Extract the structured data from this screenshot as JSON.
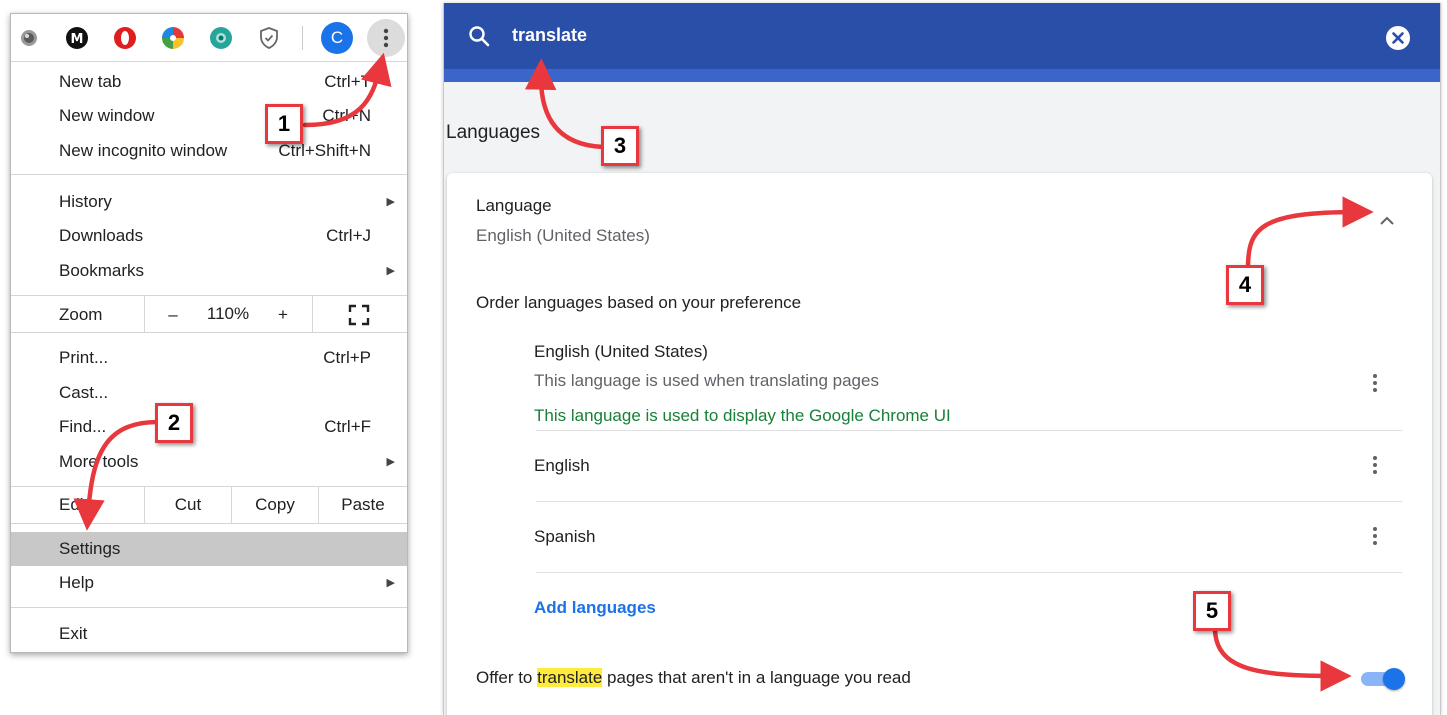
{
  "toolbar": {
    "profile_initial": "C",
    "extensions": [
      "circle-extension-icon",
      "dark-m-extension-icon",
      "opera-extension-icon",
      "colorwheel-extension-icon",
      "teal-extension-icon",
      "shield-extension-icon"
    ]
  },
  "menu": {
    "new_tab": {
      "label": "New tab",
      "shortcut": "Ctrl+T"
    },
    "new_window": {
      "label": "New window",
      "shortcut": "Ctrl+N"
    },
    "incognito": {
      "label": "New incognito window",
      "shortcut": "Ctrl+Shift+N"
    },
    "history": {
      "label": "History"
    },
    "downloads": {
      "label": "Downloads",
      "shortcut": "Ctrl+J"
    },
    "bookmarks": {
      "label": "Bookmarks"
    },
    "zoom": {
      "label": "Zoom",
      "minus": "–",
      "level": "110%",
      "plus": "+"
    },
    "print": {
      "label": "Print...",
      "shortcut": "Ctrl+P"
    },
    "cast": {
      "label": "Cast..."
    },
    "find": {
      "label": "Find...",
      "shortcut": "Ctrl+F"
    },
    "more_tools": {
      "label": "More tools"
    },
    "edit": {
      "label": "Edit",
      "cut": "Cut",
      "copy": "Copy",
      "paste": "Paste"
    },
    "settings": {
      "label": "Settings"
    },
    "help": {
      "label": "Help"
    },
    "exit": {
      "label": "Exit"
    }
  },
  "search": {
    "query": "translate"
  },
  "settings": {
    "section_title": "Languages",
    "language_label": "Language",
    "language_value": "English (United States)",
    "order_text": "Order languages based on your preference",
    "languages": [
      {
        "name": "English (United States)",
        "note": "This language is used when translating pages",
        "ui_note": "This language is used to display the Google Chrome UI"
      },
      {
        "name": "English"
      },
      {
        "name": "Spanish"
      }
    ],
    "add_languages": "Add languages",
    "offer_prefix": "Offer to ",
    "offer_highlight": "translate",
    "offer_suffix": " pages that aren't in a language you read",
    "offer_enabled": true
  },
  "annotations": [
    "1",
    "2",
    "3",
    "4",
    "5"
  ],
  "colors": {
    "accent": "#1a73e8",
    "search_bar": "#2a4fa8",
    "annotation": "#e8383d",
    "green_note": "#188038",
    "highlight": "#ffeb3b"
  }
}
